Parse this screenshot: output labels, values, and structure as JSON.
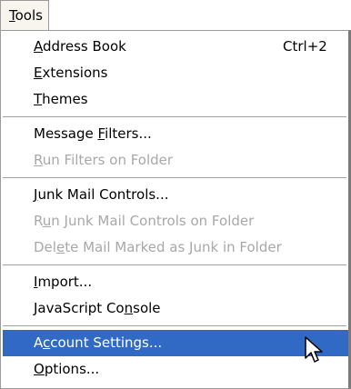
{
  "menubar": {
    "tools": {
      "pre": "",
      "mn": "T",
      "post": "ools"
    }
  },
  "menu": {
    "address_book": {
      "pre": "",
      "mn": "A",
      "post": "ddress Book",
      "shortcut": "Ctrl+2"
    },
    "extensions": {
      "pre": "",
      "mn": "E",
      "post": "xtensions"
    },
    "themes": {
      "pre": "",
      "mn": "T",
      "post": "hemes"
    },
    "message_filters": {
      "pre": "Message ",
      "mn": "F",
      "post": "ilters..."
    },
    "run_filters": {
      "pre": "",
      "mn": "R",
      "post": "un Filters on Folder"
    },
    "junk_mail_controls": {
      "pre": "",
      "mn": "J",
      "post": "unk Mail Controls..."
    },
    "run_junk_mail_controls": {
      "pre": "R",
      "mn": "u",
      "post": "n Junk Mail Controls on Folder"
    },
    "delete_junk": {
      "pre": "Del",
      "mn": "e",
      "post": "te Mail Marked as Junk in Folder"
    },
    "import": {
      "pre": "",
      "mn": "I",
      "post": "mport..."
    },
    "javascript_console": {
      "pre": "JavaScript Co",
      "mn": "n",
      "post": "sole"
    },
    "account_settings": {
      "pre": "A",
      "mn": "c",
      "post": "count Settings..."
    },
    "options": {
      "pre": "",
      "mn": "O",
      "post": "ptions..."
    }
  },
  "colors": {
    "selection": "#316ac5",
    "disabled_text": "#a8a8a8"
  },
  "cursor_icon": "arrow-cursor-icon"
}
